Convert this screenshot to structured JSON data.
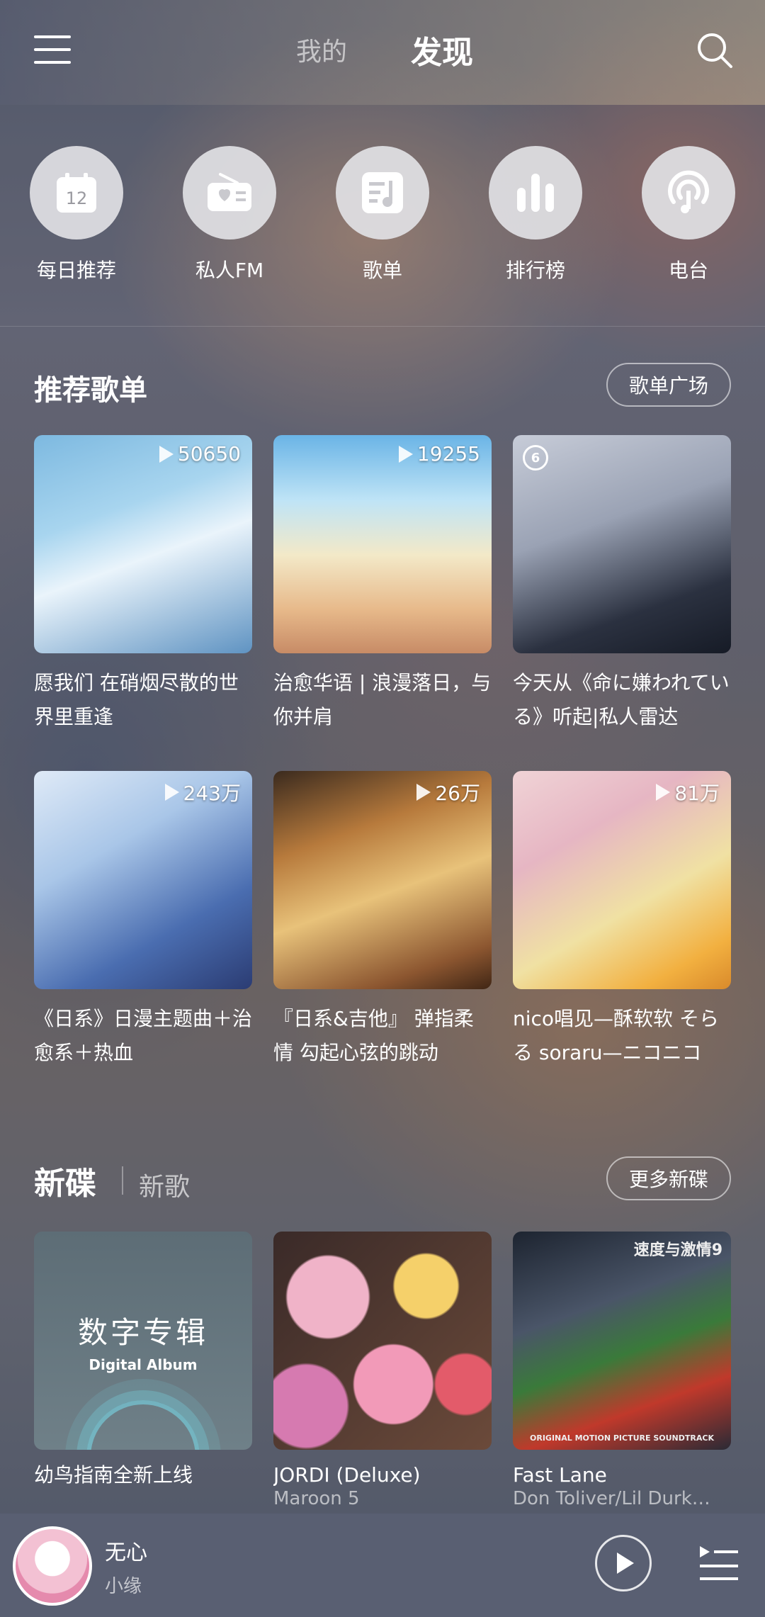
{
  "header": {
    "tab_mine": "我的",
    "tab_discover": "发现",
    "menu_icon": "hamburger-menu-icon",
    "search_icon": "search-icon"
  },
  "categories": [
    {
      "label": "每日推荐",
      "icon": "calendar-icon",
      "date": "12"
    },
    {
      "label": "私人FM",
      "icon": "radio-icon"
    },
    {
      "label": "歌单",
      "icon": "playlist-icon"
    },
    {
      "label": "排行榜",
      "icon": "bar-chart-icon"
    },
    {
      "label": "电台",
      "icon": "podcast-icon"
    }
  ],
  "recommended": {
    "title": "推荐歌单",
    "more_button": "歌单广场",
    "playlists": [
      {
        "count": "50650",
        "title": "愿我们 在硝烟尽散的世界里重逢"
      },
      {
        "count": "19255",
        "title": "治愈华语 | 浪漫落日，与你并肩"
      },
      {
        "count": "",
        "title": "今天从《命に嫌われている》听起|私人雷达",
        "badge": "6"
      },
      {
        "count": "243万",
        "title": "《日系》日漫主题曲＋治愈系＋热血"
      },
      {
        "count": "26万",
        "title": "『日系&吉他』 弹指柔情 勾起心弦的跳动"
      },
      {
        "count": "81万",
        "title": "nico唱见—酥软软 そらる soraru—ニコニコ"
      }
    ]
  },
  "new_section": {
    "tab_albums": "新碟",
    "tab_songs": "新歌",
    "more_button": "更多新碟",
    "albums": [
      {
        "title": "幼鸟指南全新上线",
        "artist": "",
        "cover_text_main": "数字专辑",
        "cover_text_sub": "Digital Album"
      },
      {
        "title": "JORDI (Deluxe)",
        "artist": "Maroon 5"
      },
      {
        "title": "Fast Lane",
        "artist": "Don Toliver/Lil Durk…",
        "cover_text_main": "速度与激情9",
        "cover_text_sub": "ORIGINAL MOTION PICTURE SOUNDTRACK"
      }
    ]
  },
  "player": {
    "song": "无心",
    "artist": "小缘",
    "play_icon": "play-icon",
    "queue_icon": "playlist-queue-icon"
  },
  "colors": {
    "text": "#ffffff",
    "icon_circle": "#e1e1e4"
  }
}
